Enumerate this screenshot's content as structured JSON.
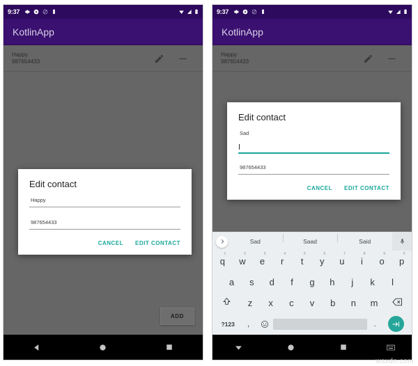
{
  "status_bar": {
    "time": "9:37",
    "left_icons": [
      "gear-icon",
      "play-icon",
      "do-not-disturb-icon",
      "battery-small-icon"
    ],
    "right_icons": [
      "wifi-icon",
      "signal-icon",
      "battery-icon"
    ]
  },
  "app": {
    "title": "KotlinApp",
    "appbar_color": "#3a1070",
    "statusbar_color": "#2d0a5e",
    "accent_color": "#1aa79a",
    "background_color": "#666666"
  },
  "contact": {
    "name": "Happy",
    "phone": "987654433",
    "edit_icon": "pencil-icon",
    "delete_icon": "minus-icon"
  },
  "add_button": {
    "label": "ADD"
  },
  "dialog_left": {
    "title": "Edit contact",
    "name_value": "Happy",
    "phone_value": "987654433",
    "cancel_label": "CANCEL",
    "confirm_label": "EDIT CONTACT",
    "focused": false
  },
  "dialog_right": {
    "title": "Edit contact",
    "name_value": "Sad",
    "phone_value": "987654433",
    "cancel_label": "CANCEL",
    "confirm_label": "EDIT CONTACT",
    "focused": true
  },
  "keyboard": {
    "suggestions": [
      "Sad",
      "Saad",
      "Said"
    ],
    "expand_icon": "chevron-right-icon",
    "mic_icon": "microphone-icon",
    "row1": [
      {
        "key": "q",
        "num": "1"
      },
      {
        "key": "w",
        "num": "2"
      },
      {
        "key": "e",
        "num": "3"
      },
      {
        "key": "r",
        "num": "4"
      },
      {
        "key": "t",
        "num": "5"
      },
      {
        "key": "y",
        "num": "6"
      },
      {
        "key": "u",
        "num": "7"
      },
      {
        "key": "i",
        "num": "8"
      },
      {
        "key": "o",
        "num": "9"
      },
      {
        "key": "p",
        "num": "0"
      }
    ],
    "row2": [
      "a",
      "s",
      "d",
      "f",
      "g",
      "h",
      "j",
      "k",
      "l"
    ],
    "row3": [
      "z",
      "x",
      "c",
      "v",
      "b",
      "n",
      "m"
    ],
    "shift_icon": "shift-icon",
    "backspace_icon": "backspace-icon",
    "symbols_label": "?123",
    "comma_label": ",",
    "emoji_icon": "emoji-icon",
    "period_label": ".",
    "enter_icon": "enter-icon",
    "space_label": ""
  },
  "nav_bar": {
    "back_icon": "back-triangle-icon",
    "home_icon": "home-circle-icon",
    "recents_icon": "recents-square-icon",
    "hide_keyboard_icon": "down-triangle-icon",
    "keyboard_icon": "keyboard-icon"
  },
  "watermark": {
    "text": "wsxdn.com"
  }
}
